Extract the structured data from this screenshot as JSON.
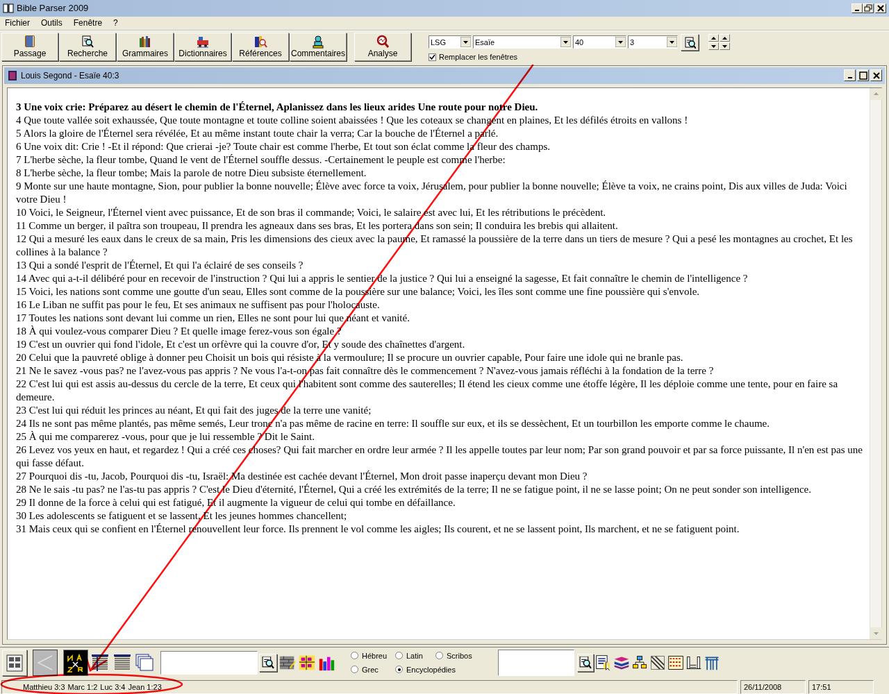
{
  "window": {
    "title": "Bible Parser 2009"
  },
  "menu": [
    "Fichier",
    "Outils",
    "Fenêtre",
    "?"
  ],
  "toolbar": [
    {
      "label": "Passage"
    },
    {
      "label": "Recherche"
    },
    {
      "label": "Grammaires"
    },
    {
      "label": "Dictionnaires"
    },
    {
      "label": "Références"
    },
    {
      "label": "Commentaires"
    },
    {
      "label": "Analyse"
    }
  ],
  "navigation": {
    "version": "LSG",
    "book": "Esaïe",
    "chapter": "40",
    "verse": "3",
    "replace_windows": {
      "label": "Remplacer les fenêtres",
      "checked": true
    }
  },
  "document": {
    "title": "Louis Segond - Esaïe 40:3",
    "verses": [
      {
        "number": "3",
        "text": "Une voix crie: Préparez au désert le chemin de l'Éternel, Aplanissez dans les lieux arides Une route pour notre Dieu.",
        "selected": true
      },
      {
        "number": "4",
        "text": "Que toute vallée soit exhaussée, Que toute montagne et toute colline soient abaissées ! Que les coteaux se changent en plaines, Et les défilés étroits en vallons !",
        "selected": false
      },
      {
        "number": "5",
        "text": "Alors la gloire de l'Éternel sera révélée, Et au même instant toute chair la verra; Car la bouche de l'Éternel a parlé.",
        "selected": false
      },
      {
        "number": "6",
        "text": "Une voix dit: Crie ! -Et il répond: Que crierai -je? Toute chair est comme l'herbe, Et tout son éclat comme la fleur des champs.",
        "selected": false
      },
      {
        "number": "7",
        "text": "L'herbe sèche, la fleur tombe, Quand le vent de l'Éternel souffle dessus. -Certainement le peuple est comme l'herbe:",
        "selected": false
      },
      {
        "number": "8",
        "text": "L'herbe sèche, la fleur tombe; Mais la parole de notre Dieu subsiste éternellement.",
        "selected": false
      },
      {
        "number": "9",
        "text": "Monte sur une haute montagne, Sion, pour publier la bonne nouvelle; Élève avec force ta voix, Jérusalem, pour publier la bonne nouvelle; Élève ta voix, ne crains point, Dis aux villes de Juda: Voici votre Dieu !",
        "selected": false
      },
      {
        "number": "10",
        "text": "Voici, le Seigneur, l'Éternel vient avec puissance, Et de son bras il commande; Voici, le salaire est avec lui, Et les rétributions le précèdent.",
        "selected": false
      },
      {
        "number": "11",
        "text": "Comme un berger, il paîtra son troupeau, Il prendra les agneaux dans ses bras, Et les portera dans son sein; Il conduira les brebis qui allaitent.",
        "selected": false
      },
      {
        "number": "12",
        "text": "Qui a mesuré les eaux dans le creux de sa main, Pris les dimensions des cieux avec la paume, Et ramassé la poussière de la terre dans un tiers de mesure ? Qui a pesé les montagnes au crochet, Et les collines à la balance ?",
        "selected": false
      },
      {
        "number": "13",
        "text": "Qui a sondé l'esprit de l'Éternel, Et qui l'a éclairé de ses conseils ?",
        "selected": false
      },
      {
        "number": "14",
        "text": "Avec qui a-t-il délibéré pour en recevoir de l'instruction ? Qui lui a appris le sentier de la justice ? Qui lui a enseigné la sagesse, Et fait connaître le chemin de l'intelligence ?",
        "selected": false
      },
      {
        "number": "15",
        "text": "Voici, les nations sont comme une goutte d'un seau, Elles sont comme de la poussière sur une balance; Voici, les îles sont comme une fine poussière qui s'envole.",
        "selected": false
      },
      {
        "number": "16",
        "text": "Le Liban ne suffit pas pour le feu, Et ses animaux ne suffisent pas pour l'holocauste.",
        "selected": false
      },
      {
        "number": "17",
        "text": "Toutes les nations sont devant lui comme un rien, Elles ne sont pour lui que néant et vanité.",
        "selected": false
      },
      {
        "number": "18",
        "text": "À qui voulez-vous comparer Dieu ? Et quelle image ferez-vous son égale ?",
        "selected": false
      },
      {
        "number": "19",
        "text": "C'est un ouvrier qui fond l'idole, Et c'est un orfèvre qui la couvre d'or, Et y soude des chaînettes d'argent.",
        "selected": false
      },
      {
        "number": "20",
        "text": "Celui que la pauvreté oblige à donner peu Choisit un bois qui résiste à la vermoulure; Il se procure un ouvrier capable, Pour faire une idole qui ne branle pas.",
        "selected": false
      },
      {
        "number": "21",
        "text": "Ne le savez -vous pas? ne l'avez-vous pas appris ? Ne vous l'a-t-on pas fait connaître dès le commencement ? N'avez-vous jamais réfléchi à la fondation de la terre ?",
        "selected": false
      },
      {
        "number": "22",
        "text": "C'est lui qui est assis au-dessus du cercle de la terre, Et ceux qui l'habitent sont comme des sauterelles; Il étend les cieux comme une étoffe légère, Il les déploie comme une tente, pour en faire sa demeure.",
        "selected": false
      },
      {
        "number": "23",
        "text": "C'est lui qui réduit les princes au néant, Et qui fait des juges de la terre une vanité;",
        "selected": false
      },
      {
        "number": "24",
        "text": "Ils ne sont pas même plantés, pas même semés, Leur tronc n'a pas même de racine en terre: Il souffle sur eux, et ils se dessèchent, Et un tourbillon les emporte comme le chaume.",
        "selected": false
      },
      {
        "number": "25",
        "text": "À qui me comparerez -vous, pour que je lui ressemble ? Dit le Saint.",
        "selected": false
      },
      {
        "number": "26",
        "text": "Levez vos yeux en haut, et regardez ! Qui a créé ces choses? Qui fait marcher en ordre leur armée ? Il les appelle toutes par leur nom; Par son grand pouvoir et par sa force puissante, Il n'en est pas une qui fasse défaut.",
        "selected": false
      },
      {
        "number": "27",
        "text": "Pourquoi dis -tu, Jacob, Pourquoi dis -tu, Israël: Ma destinée est cachée devant l'Éternel, Mon droit passe inaperçu devant mon Dieu ?",
        "selected": false
      },
      {
        "number": "28",
        "text": "Ne le sais -tu pas? ne l'as-tu pas appris ? C'est le Dieu d'éternité, l'Éternel, Qui a créé les extrémités de la terre; Il ne se fatigue point, il ne se lasse point; On ne peut sonder son intelligence.",
        "selected": false
      },
      {
        "number": "29",
        "text": "Il donne de la force à celui qui est fatigué, Et il augmente la vigueur de celui qui tombe en défaillance.",
        "selected": false
      },
      {
        "number": "30",
        "text": "Les adolescents se fatiguent et se lassent, Et les jeunes hommes chancellent;",
        "selected": false
      },
      {
        "number": "31",
        "text": "Mais ceux qui se confient en l'Éternel renouvellent leur force. Ils prennent le vol comme les aigles; Ils courent, et ne se lassent point, Ils marchent, et ne se fatiguent point.",
        "selected": false
      }
    ]
  },
  "languages": [
    {
      "label": "Hébreu",
      "selected": false
    },
    {
      "label": "Latin",
      "selected": false
    },
    {
      "label": "Scribos",
      "selected": false
    },
    {
      "label": "Grec",
      "selected": false
    },
    {
      "label": "Encyclopédies",
      "selected": true
    }
  ],
  "status_bar": {
    "references": [
      "Matthieu 3:3",
      "Marc 1:2",
      "Luc 3:4",
      "Jean 1:23"
    ],
    "date": "26/11/2008",
    "time": "17:51"
  }
}
